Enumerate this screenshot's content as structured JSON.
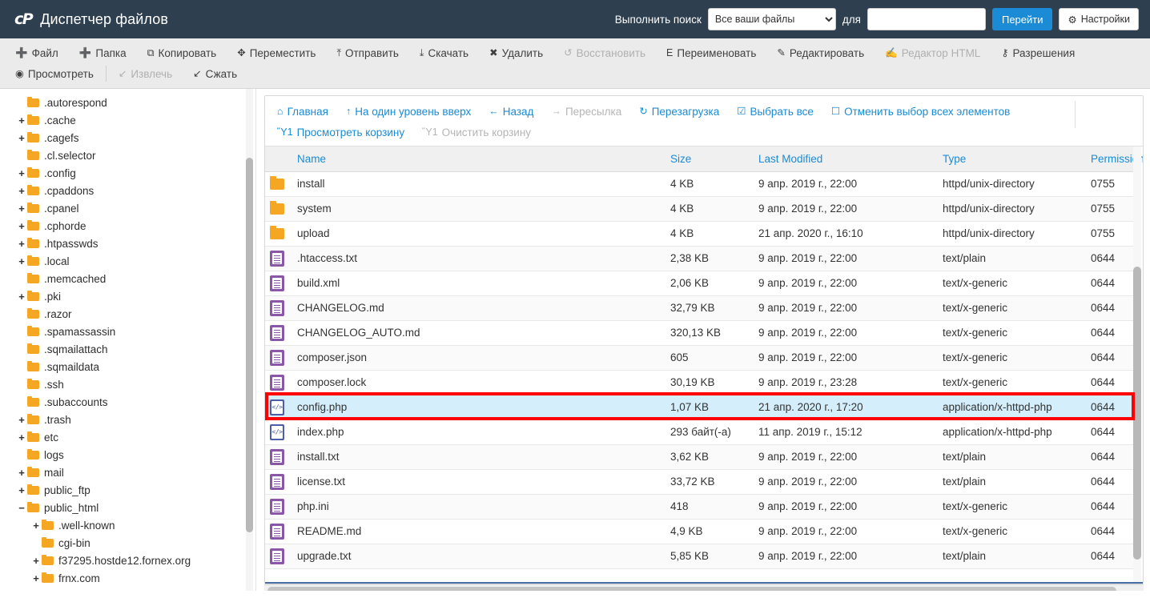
{
  "header": {
    "logo": "cP",
    "title": "Диспетчер файлов",
    "search_label": "Выполнить поиск",
    "search_scope_selected": "Все ваши файлы",
    "search_scope_options": [
      "Все ваши файлы"
    ],
    "for_label": "для",
    "search_value": "",
    "go_button": "Перейти",
    "settings_button": "Настройки",
    "gear_icon": "gear-icon",
    "accent_color": "#1a8bd4",
    "bar_color": "#2e3f50"
  },
  "toolbar": {
    "row1": [
      {
        "label": "Файл",
        "icon": "plus-icon",
        "disabled": false
      },
      {
        "label": "Папка",
        "icon": "plus-icon",
        "disabled": false
      },
      {
        "label": "Копировать",
        "icon": "copy-icon",
        "disabled": false
      },
      {
        "label": "Переместить",
        "icon": "move-icon",
        "disabled": false
      },
      {
        "label": "Отправить",
        "icon": "upload-icon",
        "disabled": false
      },
      {
        "label": "Скачать",
        "icon": "download-icon",
        "disabled": false
      },
      {
        "label": "Удалить",
        "icon": "close-x-icon",
        "disabled": false
      },
      {
        "label": "Восстановить",
        "icon": "restore-icon",
        "disabled": true
      },
      {
        "label": "Переименовать",
        "icon": "file-icon",
        "disabled": false
      },
      {
        "label": "Редактировать",
        "icon": "pencil-icon",
        "disabled": false
      },
      {
        "label": "Редактор HTML",
        "icon": "html-editor-icon",
        "disabled": true
      },
      {
        "label": "Разрешения",
        "icon": "key-icon",
        "disabled": false
      }
    ],
    "row2": [
      {
        "label": "Просмотреть",
        "icon": "eye-icon",
        "disabled": false
      },
      {
        "label": "Извлечь",
        "icon": "extract-icon",
        "disabled": true
      },
      {
        "label": "Сжать",
        "icon": "compress-icon",
        "disabled": false
      }
    ]
  },
  "sidebar": {
    "items": [
      {
        "label": ".autorespond",
        "toggle": "",
        "depth": 1
      },
      {
        "label": ".cache",
        "toggle": "+",
        "depth": 1
      },
      {
        "label": ".cagefs",
        "toggle": "+",
        "depth": 1
      },
      {
        "label": ".cl.selector",
        "toggle": "",
        "depth": 1
      },
      {
        "label": ".config",
        "toggle": "+",
        "depth": 1
      },
      {
        "label": ".cpaddons",
        "toggle": "+",
        "depth": 1
      },
      {
        "label": ".cpanel",
        "toggle": "+",
        "depth": 1
      },
      {
        "label": ".cphorde",
        "toggle": "+",
        "depth": 1
      },
      {
        "label": ".htpasswds",
        "toggle": "+",
        "depth": 1
      },
      {
        "label": ".local",
        "toggle": "+",
        "depth": 1
      },
      {
        "label": ".memcached",
        "toggle": "",
        "depth": 1
      },
      {
        "label": ".pki",
        "toggle": "+",
        "depth": 1
      },
      {
        "label": ".razor",
        "toggle": "",
        "depth": 1
      },
      {
        "label": ".spamassassin",
        "toggle": "",
        "depth": 1
      },
      {
        "label": ".sqmailattach",
        "toggle": "",
        "depth": 1
      },
      {
        "label": ".sqmaildata",
        "toggle": "",
        "depth": 1
      },
      {
        "label": ".ssh",
        "toggle": "",
        "depth": 1
      },
      {
        "label": ".subaccounts",
        "toggle": "",
        "depth": 1
      },
      {
        "label": ".trash",
        "toggle": "+",
        "depth": 1
      },
      {
        "label": "etc",
        "toggle": "+",
        "depth": 1
      },
      {
        "label": "logs",
        "toggle": "",
        "depth": 1
      },
      {
        "label": "mail",
        "toggle": "+",
        "depth": 1
      },
      {
        "label": "public_ftp",
        "toggle": "+",
        "depth": 1
      },
      {
        "label": "public_html",
        "toggle": "−",
        "depth": 1,
        "open": true
      },
      {
        "label": ".well-known",
        "toggle": "+",
        "depth": 2
      },
      {
        "label": "cgi-bin",
        "toggle": "",
        "depth": 2
      },
      {
        "label": "f37295.hostde12.fornex.org",
        "toggle": "+",
        "depth": 2
      },
      {
        "label": "frnx.com",
        "toggle": "+",
        "depth": 2
      }
    ]
  },
  "nav": {
    "row1": [
      {
        "label": "Главная",
        "icon": "home-icon",
        "disabled": false
      },
      {
        "label": "На один уровень вверх",
        "icon": "arrow-up-icon",
        "disabled": false
      },
      {
        "label": "Назад",
        "icon": "arrow-left-icon",
        "disabled": false
      },
      {
        "label": "Пересылка",
        "icon": "arrow-right-icon",
        "disabled": true
      },
      {
        "label": "Перезагрузка",
        "icon": "refresh-icon",
        "disabled": false
      },
      {
        "label": "Выбрать все",
        "icon": "checkbox-checked-icon",
        "disabled": false
      },
      {
        "label": "Отменить выбор всех элементов",
        "icon": "checkbox-empty-icon",
        "disabled": false
      }
    ],
    "row2": [
      {
        "label": "Просмотреть корзину",
        "icon": "trash-icon",
        "disabled": false
      },
      {
        "label": "Очистить корзину",
        "icon": "trash-icon",
        "disabled": true
      }
    ]
  },
  "table": {
    "columns": [
      "Name",
      "Size",
      "Last Modified",
      "Type",
      "Permissions"
    ],
    "rows": [
      {
        "name": "install",
        "size": "4 KB",
        "modified": "9 апр. 2019 г., 22:00",
        "type": "httpd/unix-directory",
        "perms": "0755",
        "kind": "dir",
        "selected": false
      },
      {
        "name": "system",
        "size": "4 KB",
        "modified": "9 апр. 2019 г., 22:00",
        "type": "httpd/unix-directory",
        "perms": "0755",
        "kind": "dir",
        "selected": false
      },
      {
        "name": "upload",
        "size": "4 KB",
        "modified": "21 апр. 2020 г., 16:10",
        "type": "httpd/unix-directory",
        "perms": "0755",
        "kind": "dir",
        "selected": false
      },
      {
        "name": ".htaccess.txt",
        "size": "2,38 KB",
        "modified": "9 апр. 2019 г., 22:00",
        "type": "text/plain",
        "perms": "0644",
        "kind": "txt",
        "selected": false
      },
      {
        "name": "build.xml",
        "size": "2,06 KB",
        "modified": "9 апр. 2019 г., 22:00",
        "type": "text/x-generic",
        "perms": "0644",
        "kind": "txt",
        "selected": false
      },
      {
        "name": "CHANGELOG.md",
        "size": "32,79 KB",
        "modified": "9 апр. 2019 г., 22:00",
        "type": "text/x-generic",
        "perms": "0644",
        "kind": "txt",
        "selected": false
      },
      {
        "name": "CHANGELOG_AUTO.md",
        "size": "320,13 KB",
        "modified": "9 апр. 2019 г., 22:00",
        "type": "text/x-generic",
        "perms": "0644",
        "kind": "txt",
        "selected": false
      },
      {
        "name": "composer.json",
        "size": "605",
        "modified": "9 апр. 2019 г., 22:00",
        "type": "text/x-generic",
        "perms": "0644",
        "kind": "txt",
        "selected": false
      },
      {
        "name": "composer.lock",
        "size": "30,19 KB",
        "modified": "9 апр. 2019 г., 23:28",
        "type": "text/x-generic",
        "perms": "0644",
        "kind": "txt",
        "selected": false
      },
      {
        "name": "config.php",
        "size": "1,07 KB",
        "modified": "21 апр. 2020 г., 17:20",
        "type": "application/x-httpd-php",
        "perms": "0644",
        "kind": "php",
        "selected": true
      },
      {
        "name": "index.php",
        "size": "293 байт(-а)",
        "modified": "11 апр. 2019 г., 15:12",
        "type": "application/x-httpd-php",
        "perms": "0644",
        "kind": "php",
        "selected": false
      },
      {
        "name": "install.txt",
        "size": "3,62 KB",
        "modified": "9 апр. 2019 г., 22:00",
        "type": "text/plain",
        "perms": "0644",
        "kind": "txt",
        "selected": false
      },
      {
        "name": "license.txt",
        "size": "33,72 KB",
        "modified": "9 апр. 2019 г., 22:00",
        "type": "text/plain",
        "perms": "0644",
        "kind": "txt",
        "selected": false
      },
      {
        "name": "php.ini",
        "size": "418",
        "modified": "9 апр. 2019 г., 22:00",
        "type": "text/x-generic",
        "perms": "0644",
        "kind": "txt",
        "selected": false
      },
      {
        "name": "README.md",
        "size": "4,9 KB",
        "modified": "9 апр. 2019 г., 22:00",
        "type": "text/x-generic",
        "perms": "0644",
        "kind": "txt",
        "selected": false
      },
      {
        "name": "upgrade.txt",
        "size": "5,85 KB",
        "modified": "9 апр. 2019 г., 22:00",
        "type": "text/plain",
        "perms": "0644",
        "kind": "txt",
        "selected": false
      }
    ]
  },
  "highlight": {
    "color": "#ff0000",
    "target_row": "config.php"
  }
}
